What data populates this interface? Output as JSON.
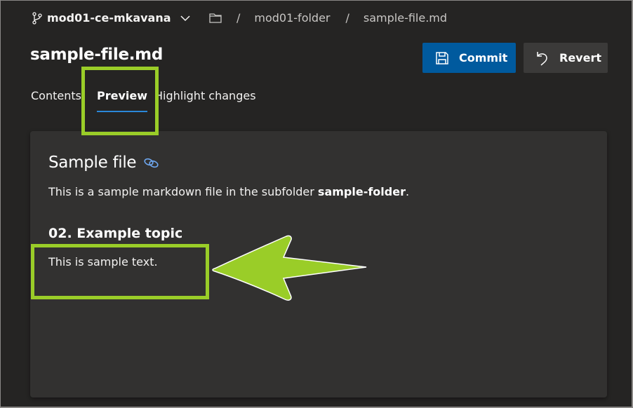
{
  "header": {
    "branch_name": "mod01-ce-mkavana",
    "breadcrumbs": [
      "mod01-folder",
      "sample-file.md"
    ],
    "separator": "/"
  },
  "file": {
    "title": "sample-file.md"
  },
  "toolbar": {
    "commit_label": "Commit",
    "revert_label": "Revert"
  },
  "tabs": [
    {
      "label": "Contents",
      "active": false
    },
    {
      "label": "Preview",
      "active": true
    },
    {
      "label": "Highlight changes",
      "active": false
    }
  ],
  "preview": {
    "heading": "Sample file",
    "paragraph_prefix": "This is a sample markdown file in the subfolder ",
    "paragraph_bold": "sample-folder",
    "paragraph_suffix": ".",
    "subheading": "02. Example topic",
    "body_text": "This is sample text."
  },
  "annotations": {
    "highlight_color": "#9acd28",
    "accent_color": "#005a9e"
  }
}
